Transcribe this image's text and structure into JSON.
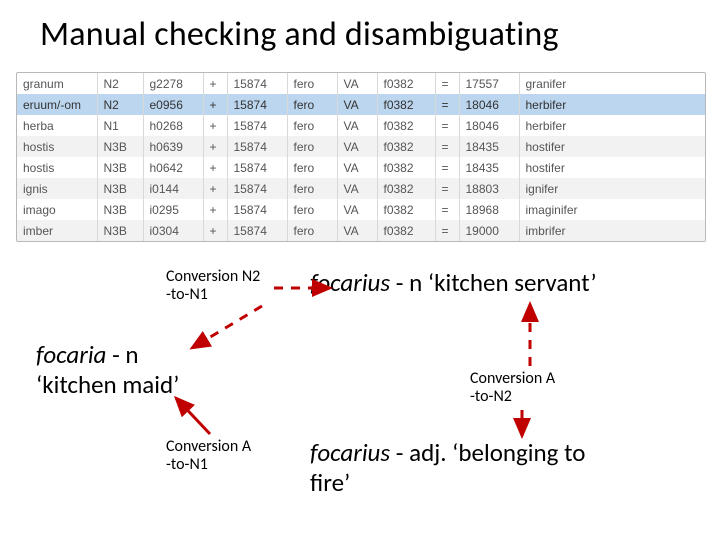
{
  "title": "Manual checking and disambiguating",
  "table": {
    "rows": [
      {
        "c": [
          "granum",
          "N2",
          "g2278",
          "+",
          "15874",
          "fero",
          "VA",
          "f0382",
          "=",
          "17557",
          "granifer"
        ],
        "cls": ""
      },
      {
        "c": [
          "eruum/-om",
          "N2",
          "e0956",
          "+",
          "15874",
          "fero",
          "VA",
          "f0382",
          "=",
          "18046",
          "herbifer"
        ],
        "cls": "sel"
      },
      {
        "c": [
          "herba",
          "N1",
          "h0268",
          "+",
          "15874",
          "fero",
          "VA",
          "f0382",
          "=",
          "18046",
          "herbifer"
        ],
        "cls": ""
      },
      {
        "c": [
          "hostis",
          "N3B",
          "h0639",
          "+",
          "15874",
          "fero",
          "VA",
          "f0382",
          "=",
          "18435",
          "hostifer"
        ],
        "cls": "alt"
      },
      {
        "c": [
          "hostis",
          "N3B",
          "h0642",
          "+",
          "15874",
          "fero",
          "VA",
          "f0382",
          "=",
          "18435",
          "hostifer"
        ],
        "cls": ""
      },
      {
        "c": [
          "ignis",
          "N3B",
          "i0144",
          "+",
          "15874",
          "fero",
          "VA",
          "f0382",
          "=",
          "18803",
          "ignifer"
        ],
        "cls": "alt"
      },
      {
        "c": [
          "imago",
          "N3B",
          "i0295",
          "+",
          "15874",
          "fero",
          "VA",
          "f0382",
          "=",
          "18968",
          "imaginifer"
        ],
        "cls": ""
      },
      {
        "c": [
          "imber",
          "N3B",
          "i0304",
          "+",
          "15874",
          "fero",
          "VA",
          "f0382",
          "=",
          "19000",
          "imbrifer"
        ],
        "cls": "alt"
      }
    ]
  },
  "labels": {
    "conv_n2_n1_a": "Conversion N2",
    "conv_n2_n1_b": "-to-N1",
    "focarius_n_it": "focarius",
    "focarius_n_rest": " - n ‘kitchen servant’",
    "focaria_it": "focaria",
    "focaria_rest": " - n",
    "focaria_line2": "‘kitchen maid’",
    "conv_a_n2_a": "Conversion A",
    "conv_a_n2_b": "-to-N2",
    "conv_a_n1_a": "Conversion A",
    "conv_a_n1_b": "-to-N1",
    "focarius_adj_it": "focarius",
    "focarius_adj_rest": " - adj. ‘belonging to",
    "focarius_adj_line2": "fire’"
  },
  "chart_data": {
    "type": "table",
    "columns": [
      "lemma",
      "class",
      "id",
      "op1",
      "num1",
      "verb",
      "vclass",
      "vid",
      "op2",
      "num2",
      "result"
    ],
    "rows": [
      [
        "granum",
        "N2",
        "g2278",
        "+",
        "15874",
        "fero",
        "VA",
        "f0382",
        "=",
        "17557",
        "granifer"
      ],
      [
        "eruum/-om",
        "N2",
        "e0956",
        "+",
        "15874",
        "fero",
        "VA",
        "f0382",
        "=",
        "18046",
        "herbifer"
      ],
      [
        "herba",
        "N1",
        "h0268",
        "+",
        "15874",
        "fero",
        "VA",
        "f0382",
        "=",
        "18046",
        "herbifer"
      ],
      [
        "hostis",
        "N3B",
        "h0639",
        "+",
        "15874",
        "fero",
        "VA",
        "f0382",
        "=",
        "18435",
        "hostifer"
      ],
      [
        "hostis",
        "N3B",
        "h0642",
        "+",
        "15874",
        "fero",
        "VA",
        "f0382",
        "=",
        "18435",
        "hostifer"
      ],
      [
        "ignis",
        "N3B",
        "i0144",
        "+",
        "15874",
        "fero",
        "VA",
        "f0382",
        "=",
        "18803",
        "ignifer"
      ],
      [
        "imago",
        "N3B",
        "i0295",
        "+",
        "15874",
        "fero",
        "VA",
        "f0382",
        "=",
        "18968",
        "imaginifer"
      ],
      [
        "imber",
        "N3B",
        "i0304",
        "+",
        "15874",
        "fero",
        "VA",
        "f0382",
        "=",
        "19000",
        "imbrifer"
      ]
    ]
  }
}
